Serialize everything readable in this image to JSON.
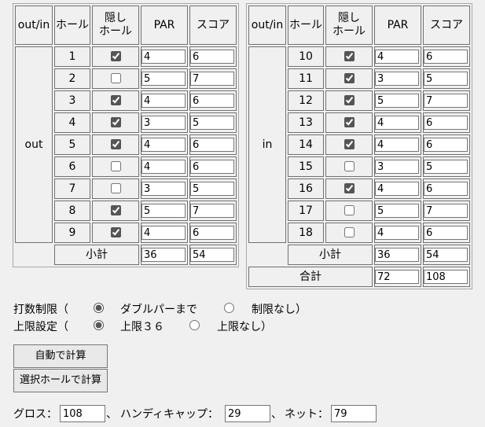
{
  "headers": {
    "out_in": "out/in",
    "hole": "ホール",
    "hidden_line1": "隠し",
    "hidden_line2": "ホール",
    "par": "PAR",
    "score": "スコア"
  },
  "out": {
    "label": "out",
    "rows": [
      {
        "hole": "1",
        "hidden": true,
        "par": "4",
        "score": "6"
      },
      {
        "hole": "2",
        "hidden": false,
        "par": "5",
        "score": "7"
      },
      {
        "hole": "3",
        "hidden": true,
        "par": "4",
        "score": "6"
      },
      {
        "hole": "4",
        "hidden": true,
        "par": "3",
        "score": "5"
      },
      {
        "hole": "5",
        "hidden": true,
        "par": "4",
        "score": "6"
      },
      {
        "hole": "6",
        "hidden": false,
        "par": "4",
        "score": "6"
      },
      {
        "hole": "7",
        "hidden": false,
        "par": "3",
        "score": "5"
      },
      {
        "hole": "8",
        "hidden": true,
        "par": "5",
        "score": "7"
      },
      {
        "hole": "9",
        "hidden": true,
        "par": "4",
        "score": "6"
      }
    ],
    "subtotal_label": "小計",
    "subtotal_par": "36",
    "subtotal_score": "54"
  },
  "in": {
    "label": "in",
    "rows": [
      {
        "hole": "10",
        "hidden": true,
        "par": "4",
        "score": "6"
      },
      {
        "hole": "11",
        "hidden": true,
        "par": "3",
        "score": "5"
      },
      {
        "hole": "12",
        "hidden": true,
        "par": "5",
        "score": "7"
      },
      {
        "hole": "13",
        "hidden": true,
        "par": "4",
        "score": "6"
      },
      {
        "hole": "14",
        "hidden": true,
        "par": "4",
        "score": "6"
      },
      {
        "hole": "15",
        "hidden": false,
        "par": "3",
        "score": "5"
      },
      {
        "hole": "16",
        "hidden": true,
        "par": "4",
        "score": "6"
      },
      {
        "hole": "17",
        "hidden": false,
        "par": "5",
        "score": "7"
      },
      {
        "hole": "18",
        "hidden": false,
        "par": "4",
        "score": "6"
      }
    ],
    "subtotal_label": "小計",
    "subtotal_par": "36",
    "subtotal_score": "54",
    "total_label": "合計",
    "total_par": "72",
    "total_score": "108"
  },
  "options": {
    "stroke_limit_label": "打数制限（",
    "stroke_limit_opt1": "ダブルパーまで",
    "stroke_limit_opt2": "制限なし）",
    "stroke_limit_selected": "ダブルパーまで",
    "cap_label": "上限設定（",
    "cap_opt1": "上限３６",
    "cap_opt2": "上限なし）",
    "cap_selected": "上限３６"
  },
  "buttons": {
    "auto_calc": "自動で計算",
    "selected_calc": "選択ホールで計算"
  },
  "results": {
    "gross_label": "グロス：",
    "gross_value": "108",
    "sep1": "、",
    "handicap_label": "ハンディキャップ：",
    "handicap_value": "29",
    "sep2": "、",
    "net_label": "ネット：",
    "net_value": "79"
  }
}
